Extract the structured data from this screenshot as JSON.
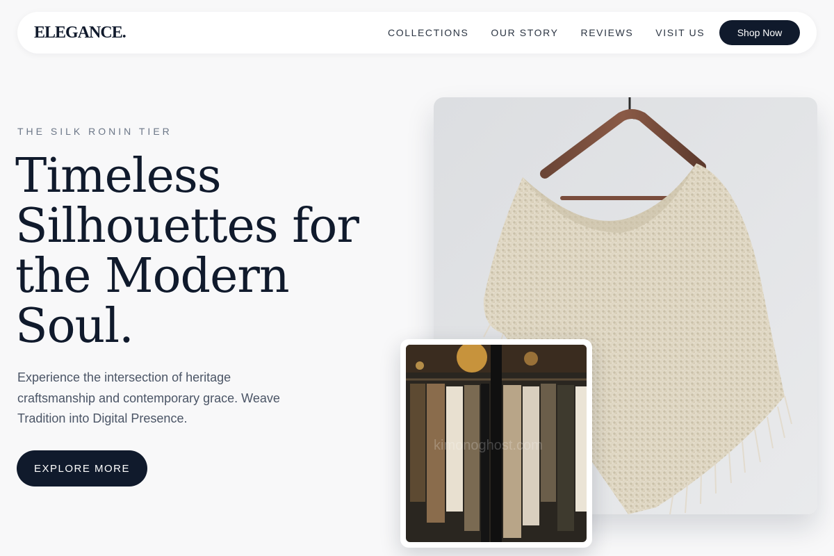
{
  "header": {
    "logo": "ELEGANCE.",
    "nav": [
      "COLLECTIONS",
      "OUR STORY",
      "REVIEWS",
      "VISIT US"
    ],
    "cta": "Shop Now"
  },
  "hero": {
    "eyebrow": "THE SILK RONIN TIER",
    "headline_lines": [
      "Timeless",
      "Silhouettes for",
      "the Modern",
      "Soul."
    ],
    "lead": "Experience the intersection of heritage craftsmanship and contemporary grace. Weave Tradition into Digital Presence.",
    "button": "EXPLORE MORE"
  },
  "images": {
    "inset_watermark": "kimonoghost.com"
  },
  "colors": {
    "brand_navy": "#101a2c",
    "background": "#f8f8f9",
    "muted_text": "#6b7687"
  }
}
